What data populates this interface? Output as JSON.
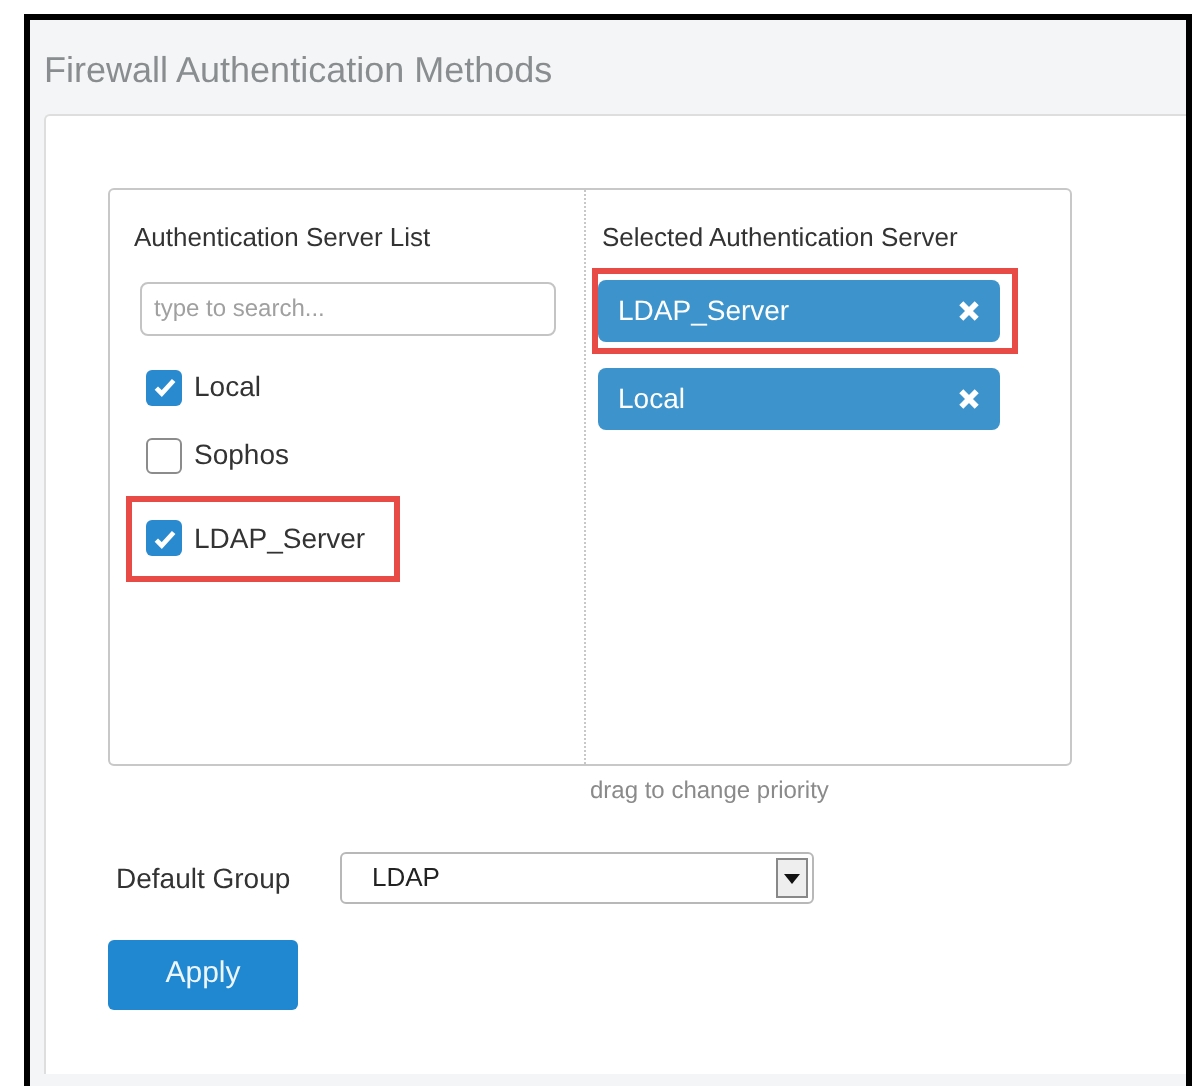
{
  "panel": {
    "title": "Firewall Authentication Methods"
  },
  "server_list": {
    "heading": "Authentication Server List",
    "search": {
      "placeholder": "type to search..."
    },
    "items": [
      {
        "label": "Local",
        "checked": true,
        "highlighted": false
      },
      {
        "label": "Sophos",
        "checked": false,
        "highlighted": false
      },
      {
        "label": "LDAP_Server",
        "checked": true,
        "highlighted": true
      }
    ]
  },
  "selected_servers": {
    "heading": "Selected Authentication Server",
    "items": [
      {
        "label": "LDAP_Server",
        "highlighted": true
      },
      {
        "label": "Local",
        "highlighted": false
      }
    ]
  },
  "hint": "drag to change priority",
  "default_group": {
    "label": "Default Group",
    "value": "LDAP"
  },
  "buttons": [
    "Apply"
  ]
}
